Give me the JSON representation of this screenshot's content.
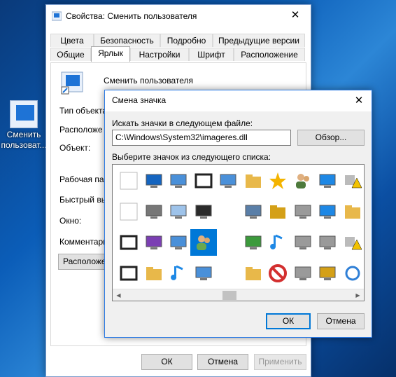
{
  "desktop": {
    "icon_label_1": "Сменить",
    "icon_label_2": "пользоват..."
  },
  "props": {
    "title": "Свойства: Сменить пользователя",
    "tabs_row1": [
      "Цвета",
      "Безопасность",
      "Подробно",
      "Предыдущие версии"
    ],
    "tabs_row2": [
      "Общие",
      "Ярлык",
      "Настройки",
      "Шрифт",
      "Расположение"
    ],
    "shortcut_name": "Сменить пользователя",
    "labels": [
      "Тип объекта",
      "Расположе",
      "Объект:",
      "Рабочая папк",
      "Быстрый вы",
      "Окно:",
      "Комментари"
    ],
    "location_button": "Расположен",
    "ok": "ОК",
    "cancel": "Отмена",
    "apply": "Применить"
  },
  "dialog": {
    "title": "Смена значка",
    "search_label": "Искать значки в следующем файле:",
    "file_path": "C:\\Windows\\System32\\imageres.dll",
    "browse": "Обзор...",
    "list_label": "Выберите значок из следующего списка:",
    "ok": "ОК",
    "cancel": "Отмена",
    "icons": [
      [
        "blank-page-icon",
        "shield-globe-icon",
        "network-pc-icon",
        "film-reel-icon",
        "network-pc-2-icon",
        "folder-music-icon",
        "star-icon",
        "user-avatar-icon",
        "windows-lock-icon",
        "warning-drive-icon"
      ],
      [
        "blank-page-2-icon",
        "printer-icon",
        "document-icon",
        "monitor-icon",
        "",
        "display-settings-icon",
        "search-folder-icon",
        "drive-lock-icon",
        "windows-tiles-icon",
        "folder-cloud-icon"
      ],
      [
        "filmstrip-icon",
        "media-pc-icon",
        "laptop-icon",
        "users-icon",
        "",
        "sync-monitor-icon",
        "music-note-icon",
        "drive-icon",
        "drive-2-icon",
        "warning-lock-icon"
      ],
      [
        "filmstrip-2-icon",
        "library-folder-icon",
        "music-note-2-icon",
        "network-dots-icon",
        "",
        "folder-lock-icon",
        "no-entry-icon",
        "drive-warning-icon",
        "lock-warning-icon",
        "refresh-icon"
      ]
    ],
    "selected": "users-icon"
  }
}
